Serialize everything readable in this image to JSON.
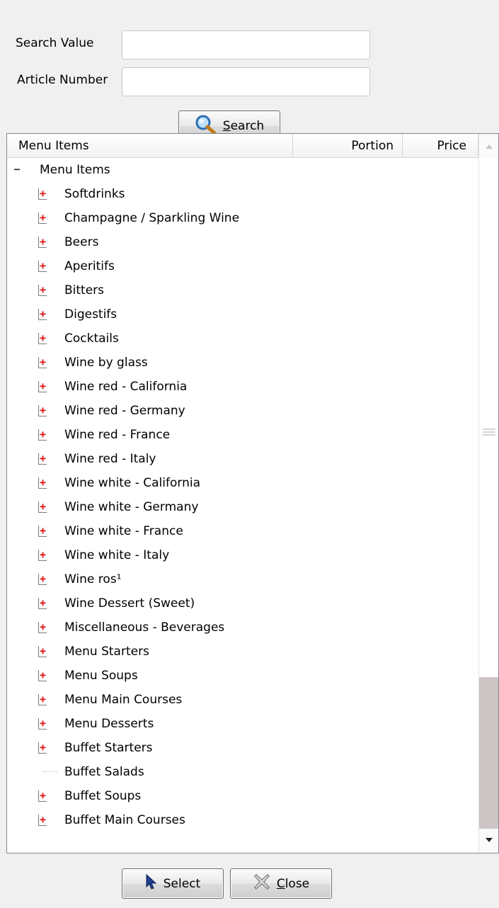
{
  "form": {
    "search_value_label": "Search Value",
    "search_value": "",
    "article_number_label": "Article Number",
    "article_number": "",
    "search_button_prefix": "",
    "search_button_mnemonic": "S",
    "search_button_rest": "earch"
  },
  "tree": {
    "columns": [
      "Menu Items",
      "Portion",
      "Price"
    ],
    "root_label": "Menu Items",
    "items": [
      "Softdrinks",
      "Champagne / Sparkling Wine",
      "Beers",
      "Aperitifs",
      "Bitters",
      "Digestifs",
      "Cocktails",
      "Wine by glass",
      "Wine red - California",
      "Wine red - Germany",
      "Wine red - France",
      "Wine red - Italy",
      "Wine white - California",
      "Wine white - Germany",
      "Wine white - France",
      "Wine white - Italy",
      "Wine ros¹",
      "Wine Dessert (Sweet)",
      "Miscellaneous - Beverages",
      "Menu Starters",
      "Menu Soups",
      "Menu Main Courses",
      "Menu Desserts",
      "Buffet Starters",
      "Buffet Salads",
      "Buffet Soups",
      "Buffet Main Courses"
    ],
    "leaf_items": [
      "Buffet Salads"
    ],
    "expand_symbol": "+",
    "collapse_symbol": "−"
  },
  "footer": {
    "select_label": "Select",
    "close_prefix": "",
    "close_mnemonic": "C",
    "close_rest": "lose"
  },
  "icons": {
    "search": "magnifier-icon",
    "select": "cursor-arrow-icon",
    "close": "close-x-icon"
  },
  "colors": {
    "expander": "#dd1111",
    "scroll_thumb": "#cdc6c6",
    "background": "#f0f0f0"
  }
}
